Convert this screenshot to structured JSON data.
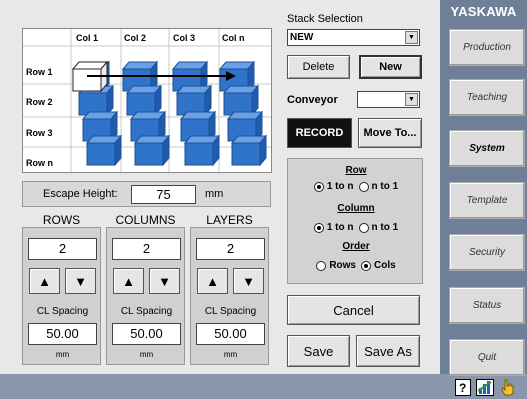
{
  "brand": "YASKAWA",
  "sidebar": {
    "items": [
      {
        "label": "Production"
      },
      {
        "label": "Teaching"
      },
      {
        "label": "System"
      },
      {
        "label": "Template"
      },
      {
        "label": "Security"
      },
      {
        "label": "Status"
      },
      {
        "label": "Quit"
      }
    ]
  },
  "diagram": {
    "columns": [
      "Col 1",
      "Col 2",
      "Col 3",
      "Col n"
    ],
    "rows": [
      "Row 1",
      "Row 2",
      "Row 3",
      "Row n"
    ],
    "box_color": "#2f74c8",
    "highlight_color": "#ffffff"
  },
  "escape": {
    "label": "Escape Height:",
    "value": "75",
    "unit": "mm"
  },
  "dimensions": {
    "rows": {
      "header": "ROWS",
      "value": "2",
      "cl_label": "CL Spacing",
      "cl_value": "50.00",
      "unit": "mm"
    },
    "columns": {
      "header": "COLUMNS",
      "value": "2",
      "cl_label": "CL Spacing",
      "cl_value": "50.00",
      "unit": "mm"
    },
    "layers": {
      "header": "LAYERS",
      "value": "2",
      "cl_label": "CL Spacing",
      "cl_value": "50.00",
      "unit": "mm"
    },
    "up_icon": "up-triangle-icon",
    "down_icon": "down-triangle-icon"
  },
  "stack": {
    "label": "Stack Selection",
    "selected": "NEW",
    "delete_label": "Delete",
    "new_label": "New"
  },
  "conveyor": {
    "label": "Conveyor",
    "selected": ""
  },
  "record_label": "RECORD",
  "moveto_label": "Move To...",
  "order": {
    "row_head": "Row",
    "row_opt1": "1 to n",
    "row_opt2": "n to 1",
    "col_head": "Column",
    "col_opt1": "1 to n",
    "col_opt2": "n to 1",
    "order_head": "Order",
    "order_opt1": "Rows",
    "order_opt2": "Cols"
  },
  "cancel_label": "Cancel",
  "save_label": "Save",
  "saveas_label": "Save As"
}
